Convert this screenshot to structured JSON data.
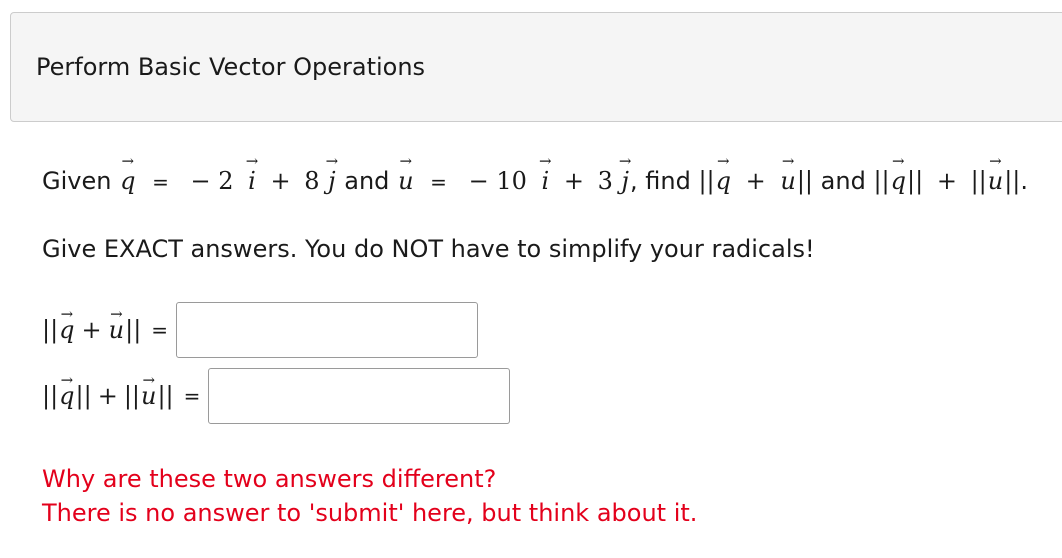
{
  "header": {
    "title": "Perform Basic Vector Operations"
  },
  "problem": {
    "given_word": "Given",
    "q_name": "q",
    "equals": "=",
    "q_expr_coef_i": "− 2",
    "i_name": "i",
    "plus": "+",
    "q_expr_coef_j": "8",
    "j_name": "j",
    "and_word": "and",
    "u_name": "u",
    "u_expr_coef_i": "− 10",
    "u_expr_coef_j": "3",
    "comma": ",",
    "find_word": "find",
    "norm_open": "||",
    "norm_close": "||",
    "period": "."
  },
  "instruction": "Give EXACT answers. You do NOT have to simplify your radicals!",
  "answers": [
    {
      "equals": "=",
      "value": ""
    },
    {
      "equals": "=",
      "value": ""
    }
  ],
  "followup": {
    "line1": "Why are these two answers different?",
    "line2": "There is no answer to 'submit' here, but think about it."
  },
  "colors": {
    "followup": "#e3001b",
    "header_bg": "#f5f5f5"
  }
}
